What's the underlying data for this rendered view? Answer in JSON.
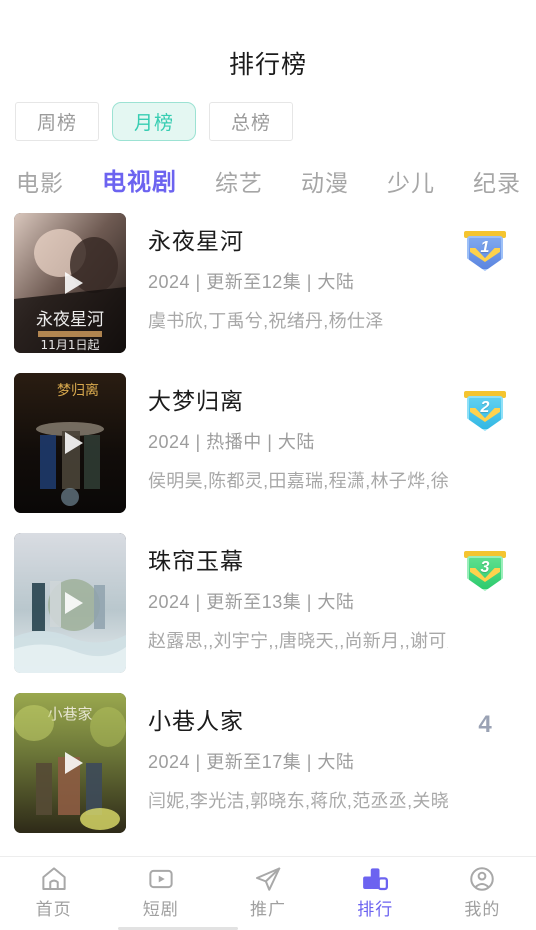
{
  "header": {
    "title": "排行榜"
  },
  "period_filter": {
    "items": [
      {
        "label": "周榜",
        "active": false
      },
      {
        "label": "月榜",
        "active": true
      },
      {
        "label": "总榜",
        "active": false
      }
    ]
  },
  "category_tabs": {
    "items": [
      {
        "label": "电影",
        "active": false
      },
      {
        "label": "电视剧",
        "active": true
      },
      {
        "label": "综艺",
        "active": false
      },
      {
        "label": "动漫",
        "active": false
      },
      {
        "label": "少儿",
        "active": false
      },
      {
        "label": "纪录",
        "active": false
      }
    ]
  },
  "ranking_list": {
    "items": [
      {
        "rank": "1",
        "rank_style": "badge-gold-blue",
        "title": "永夜星河",
        "meta": "2024 | 更新至12集 | 大陆",
        "cast": "虞书欣,丁禹兮,祝绪丹,杨仕泽",
        "poster_alt": "永夜星河 海报"
      },
      {
        "rank": "2",
        "rank_style": "badge-gold-cyan",
        "title": "大梦归离",
        "meta": "2024 | 热播中 | 大陆",
        "cast": "侯明昊,陈都灵,田嘉瑞,程潇,林子烨,徐振轩,...",
        "poster_alt": "大梦归离 海报"
      },
      {
        "rank": "3",
        "rank_style": "badge-gold-green",
        "title": "珠帘玉幕",
        "meta": "2024 | 更新至13集 | 大陆",
        "cast": "赵露思,,刘宇宁,,唐晓天,,尚新月,,谢可寅,,唐...",
        "poster_alt": "珠帘玉幕 海报"
      },
      {
        "rank": "4",
        "rank_style": "plain",
        "title": "小巷人家",
        "meta": "2024 | 更新至17集 | 大陆",
        "cast": "闫妮,李光洁,郭晓东,蒋欣,范丞丞,关晓彤,王...",
        "poster_alt": "小巷人家 海报"
      }
    ]
  },
  "bottom_nav": {
    "items": [
      {
        "label": "首页",
        "icon": "home-icon",
        "active": false
      },
      {
        "label": "短剧",
        "icon": "video-icon",
        "active": false
      },
      {
        "label": "推广",
        "icon": "paper-plane-icon",
        "active": false
      },
      {
        "label": "排行",
        "icon": "bar-chart-icon",
        "active": true
      },
      {
        "label": "我的",
        "icon": "user-circle-icon",
        "active": false
      }
    ]
  },
  "colors": {
    "accent_purple": "#6C63F0",
    "accent_teal": "#37CDB2",
    "pill_active_bg": "#E4F7F2",
    "text_primary": "#1C1C1C",
    "text_muted": "#A0A0A0",
    "badge_gold": "#F4C430"
  }
}
